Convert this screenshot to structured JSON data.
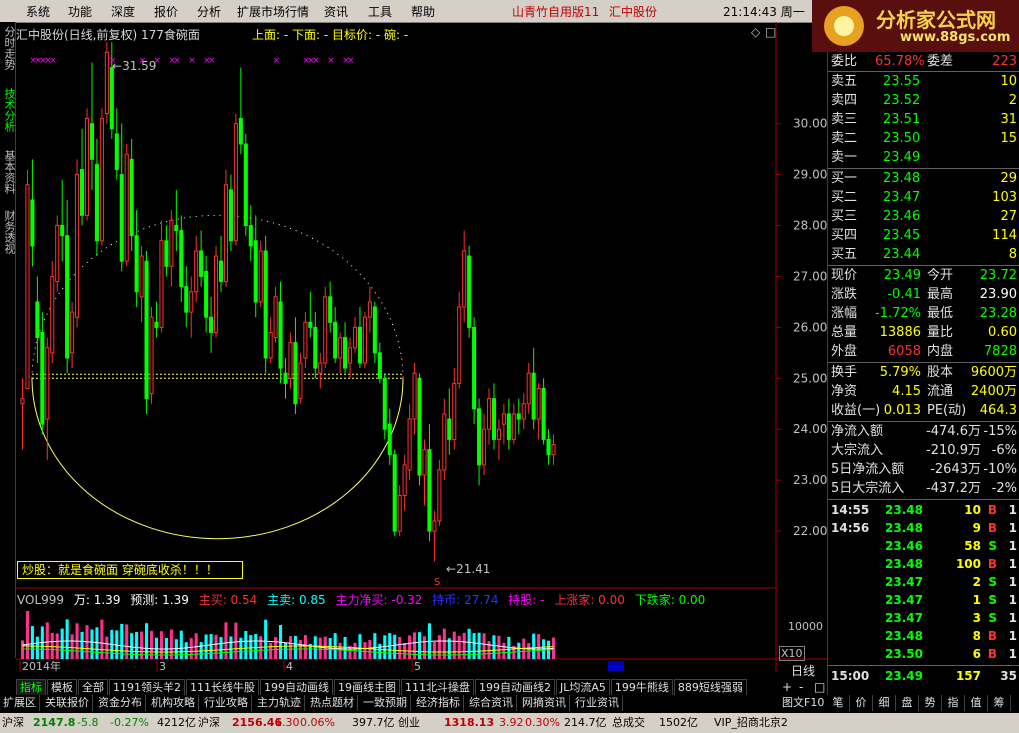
{
  "menu": {
    "items": [
      "系统",
      "功能",
      "深度",
      "报价",
      "分析",
      "扩展市场行情",
      "资讯",
      "工具",
      "帮助"
    ],
    "app_title": "山青竹自用版11",
    "stock_name": "汇中股份",
    "clock": "21:14:43 周一",
    "logo_text": "分析家公式网",
    "logo_url": "www.88gs.com"
  },
  "left_tabs": [
    "分时走势",
    "技术分析",
    "基本资料",
    "财务透视"
  ],
  "chart": {
    "title": "汇中股份(日线,前复权) 177食碗面",
    "info": "上面: -  下面: -  目标价: -  碗: -",
    "high_label": "31.59",
    "low_label": "21.41",
    "formula_text": "炒股：就是食碗面   穿碗底收杀！！！",
    "bottom_marker": "S"
  },
  "chart_data": {
    "type": "candlestick",
    "y_ticks": [
      "30.00",
      "29.00",
      "28.00",
      "27.00",
      "26.00",
      "25.00",
      "24.00",
      "23.00",
      "22.00"
    ],
    "ylim": [
      21.0,
      31.8
    ],
    "x_labels": [
      "2014年",
      "3",
      "4",
      "5"
    ],
    "candles": [
      [
        24.5,
        25.0,
        23.6,
        24.6
      ],
      [
        24.8,
        29.1,
        24.8,
        28.8
      ],
      [
        28.5,
        29.3,
        27.2,
        27.6
      ],
      [
        26.5,
        27.0,
        25.3,
        25.8
      ],
      [
        25.9,
        26.3,
        23.9,
        24.1
      ],
      [
        24.2,
        25.8,
        23.4,
        25.6
      ],
      [
        25.5,
        27.3,
        25.3,
        27.0
      ],
      [
        26.9,
        28.2,
        26.7,
        28.0
      ],
      [
        28.0,
        28.9,
        27.3,
        27.8
      ],
      [
        27.8,
        28.5,
        25.1,
        25.4
      ],
      [
        25.5,
        26.5,
        25.2,
        26.3
      ],
      [
        26.2,
        29.3,
        26.0,
        29.0
      ],
      [
        29.1,
        29.9,
        28.0,
        28.2
      ],
      [
        28.2,
        30.3,
        28.1,
        30.1
      ],
      [
        30.0,
        31.2,
        28.7,
        29.3
      ],
      [
        29.2,
        29.7,
        27.4,
        27.7
      ],
      [
        27.7,
        30.3,
        27.6,
        30.1
      ],
      [
        30.2,
        31.6,
        30.0,
        31.4
      ],
      [
        31.1,
        31.6,
        29.7,
        29.9
      ],
      [
        29.8,
        30.3,
        28.9,
        29.1
      ],
      [
        29.0,
        30.0,
        27.1,
        27.3
      ],
      [
        27.3,
        29.6,
        27.2,
        29.4
      ],
      [
        29.3,
        29.7,
        27.5,
        27.8
      ],
      [
        27.8,
        28.3,
        26.4,
        26.7
      ],
      [
        26.6,
        27.6,
        26.1,
        27.4
      ],
      [
        27.3,
        27.5,
        24.3,
        24.6
      ],
      [
        24.7,
        26.4,
        24.5,
        26.2
      ],
      [
        26.1,
        26.5,
        25.8,
        26.0
      ],
      [
        26.0,
        28.1,
        25.9,
        27.7
      ],
      [
        27.7,
        28.0,
        27.0,
        27.2
      ],
      [
        27.2,
        28.3,
        26.8,
        28.1
      ],
      [
        28.0,
        28.7,
        27.5,
        27.9
      ],
      [
        27.9,
        28.2,
        26.5,
        26.8
      ],
      [
        26.8,
        27.2,
        26.0,
        26.3
      ],
      [
        26.3,
        27.0,
        25.8,
        26.7
      ],
      [
        26.7,
        27.8,
        26.5,
        27.5
      ],
      [
        27.5,
        27.9,
        26.8,
        27.0
      ],
      [
        27.1,
        27.4,
        25.9,
        26.2
      ],
      [
        26.2,
        26.6,
        25.5,
        25.9
      ],
      [
        25.9,
        27.6,
        25.8,
        27.4
      ],
      [
        27.3,
        27.8,
        26.7,
        26.9
      ],
      [
        26.9,
        29.1,
        26.8,
        28.8
      ],
      [
        28.7,
        29.0,
        27.5,
        27.7
      ],
      [
        27.7,
        30.2,
        27.6,
        30.0
      ],
      [
        30.1,
        31.1,
        29.4,
        29.6
      ],
      [
        29.6,
        29.8,
        27.8,
        28.0
      ],
      [
        28.0,
        28.4,
        27.3,
        27.6
      ],
      [
        27.7,
        28.2,
        26.2,
        26.5
      ],
      [
        26.5,
        27.7,
        26.4,
        27.5
      ],
      [
        27.5,
        27.8,
        25.1,
        25.4
      ],
      [
        25.4,
        26.2,
        25.3,
        25.9
      ],
      [
        25.8,
        26.8,
        25.7,
        26.6
      ],
      [
        26.5,
        26.9,
        24.9,
        25.2
      ],
      [
        25.1,
        25.4,
        24.6,
        24.9
      ],
      [
        25.0,
        25.9,
        24.8,
        25.7
      ],
      [
        25.7,
        26.2,
        24.3,
        24.5
      ],
      [
        24.6,
        25.5,
        24.5,
        25.3
      ],
      [
        25.4,
        26.3,
        25.2,
        26.1
      ],
      [
        26.1,
        26.7,
        25.8,
        26.0
      ],
      [
        26.0,
        26.3,
        25.0,
        25.2
      ],
      [
        25.1,
        25.5,
        24.8,
        25.3
      ],
      [
        25.3,
        26.8,
        25.2,
        26.6
      ],
      [
        26.6,
        26.9,
        25.9,
        26.1
      ],
      [
        26.1,
        26.4,
        25.3,
        25.4
      ],
      [
        25.4,
        25.9,
        25.1,
        25.8
      ],
      [
        25.8,
        26.1,
        25.1,
        25.2
      ],
      [
        25.3,
        25.8,
        25.0,
        25.6
      ],
      [
        25.6,
        26.2,
        25.5,
        26.0
      ],
      [
        26.0,
        26.4,
        25.2,
        25.3
      ],
      [
        25.3,
        26.3,
        25.2,
        26.2
      ],
      [
        26.2,
        26.8,
        25.9,
        26.5
      ],
      [
        26.4,
        26.5,
        25.3,
        25.5
      ],
      [
        25.5,
        25.7,
        24.9,
        25.0
      ],
      [
        25.0,
        25.1,
        23.8,
        24.0
      ],
      [
        24.1,
        24.4,
        23.3,
        23.5
      ],
      [
        23.5,
        23.6,
        21.9,
        22.0
      ],
      [
        22.0,
        22.9,
        21.9,
        22.7
      ],
      [
        22.7,
        23.5,
        22.4,
        23.3
      ],
      [
        23.2,
        24.5,
        23.0,
        24.2
      ],
      [
        24.2,
        25.3,
        23.9,
        25.1
      ],
      [
        25.0,
        25.1,
        22.9,
        23.1
      ],
      [
        23.1,
        23.8,
        22.5,
        23.6
      ],
      [
        23.6,
        24.1,
        21.8,
        22.0
      ],
      [
        22.0,
        22.4,
        21.4,
        22.2
      ],
      [
        22.2,
        23.4,
        22.1,
        23.2
      ],
      [
        23.2,
        24.6,
        23.0,
        24.3
      ],
      [
        24.2,
        24.8,
        23.5,
        23.8
      ],
      [
        23.8,
        25.2,
        23.6,
        24.9
      ],
      [
        24.9,
        26.7,
        24.8,
        26.4
      ],
      [
        26.4,
        27.9,
        26.1,
        27.5
      ],
      [
        27.4,
        27.6,
        25.8,
        26.0
      ],
      [
        26.0,
        26.2,
        24.1,
        24.4
      ],
      [
        24.4,
        24.6,
        22.9,
        23.3
      ],
      [
        23.3,
        24.3,
        23.1,
        24.0
      ],
      [
        24.0,
        24.8,
        23.7,
        24.6
      ],
      [
        24.6,
        24.9,
        23.6,
        23.8
      ],
      [
        23.8,
        24.2,
        23.4,
        24.0
      ],
      [
        24.1,
        24.5,
        23.7,
        24.3
      ],
      [
        24.3,
        24.6,
        23.6,
        23.8
      ],
      [
        23.8,
        24.5,
        23.7,
        24.3
      ],
      [
        24.3,
        24.6,
        23.9,
        24.2
      ],
      [
        24.2,
        24.7,
        24.0,
        24.5
      ],
      [
        24.5,
        25.3,
        24.3,
        25.1
      ],
      [
        25.1,
        25.6,
        24.0,
        24.2
      ],
      [
        24.2,
        24.9,
        23.8,
        24.8
      ],
      [
        24.8,
        25.0,
        23.7,
        23.8
      ],
      [
        23.8,
        24.0,
        23.3,
        23.5
      ],
      [
        23.5,
        23.9,
        23.3,
        23.7
      ]
    ],
    "volume_label": "10000",
    "x10": "X10"
  },
  "vol_header": {
    "vol": "VOL999",
    "items": [
      {
        "label": "万: 1.39",
        "color": "#ffffff"
      },
      {
        "label": "预测: 1.39",
        "color": "#ffffff"
      },
      {
        "label": "主买: 0.54",
        "color": "#ff3030"
      },
      {
        "label": "主卖: 0.85",
        "color": "#00ffff"
      },
      {
        "label": "主力净买: -0.32",
        "color": "#ff00ff"
      },
      {
        "label": "持币: 27.74",
        "color": "#3030ff"
      },
      {
        "label": "持股: -",
        "color": "#ff00ff"
      },
      {
        "label": "上涨家: 0.00",
        "color": "#ff3030"
      },
      {
        "label": "下跌家: 0.00",
        "color": "#00ff00"
      }
    ]
  },
  "period_label": "日线",
  "tabs1": [
    "指标",
    "模板",
    "全部",
    "1191领头羊2",
    "111长线牛股",
    "199自动画线",
    "19画线主图",
    "111北斗操盘",
    "199自动画线2",
    "JL均流A5",
    "199牛熊线",
    "889短线强弱"
  ],
  "tabs2": [
    "扩展区",
    "关联报价",
    "资金分布",
    "机构攻略",
    "行业攻略",
    "主力轨迹",
    "热点题材",
    "一致预期",
    "经济指标",
    "综合资讯",
    "网摘资讯",
    "行业资讯"
  ],
  "tabs2_right": "图文F10",
  "status": [
    {
      "t": "沪深",
      "c": "#000000"
    },
    {
      "t": "2147.8",
      "c": "#008000"
    },
    {
      "t": "-5.8",
      "c": "#008000"
    },
    {
      "t": "-0.27%",
      "c": "#008000"
    },
    {
      "t": "4212亿",
      "c": "#000000"
    },
    {
      "t": "沪深",
      "c": "#000000"
    },
    {
      "t": "2156.46",
      "c": "#c00000"
    },
    {
      "t": "1.30",
      "c": "#c00000"
    },
    {
      "t": "0.06%",
      "c": "#c00000"
    },
    {
      "t": "397.7亿",
      "c": "#000000"
    },
    {
      "t": "创业",
      "c": "#000000"
    },
    {
      "t": "1318.13",
      "c": "#c00000"
    },
    {
      "t": "3.92",
      "c": "#c00000"
    },
    {
      "t": "0.30%",
      "c": "#c00000"
    },
    {
      "t": "214.7亿",
      "c": "#000000"
    },
    {
      "t": "总成交",
      "c": "#000000"
    },
    {
      "t": "1502亿",
      "c": "#000000"
    },
    {
      "t": "VIP_招商北京2",
      "c": "#000000"
    }
  ],
  "quote": {
    "ratio": {
      "l1": "委比",
      "v1": "65.78%",
      "l2": "委差",
      "v2": "223"
    },
    "sell": [
      {
        "l": "卖五",
        "p": "23.55",
        "q": "10"
      },
      {
        "l": "卖四",
        "p": "23.52",
        "q": "2"
      },
      {
        "l": "卖三",
        "p": "23.51",
        "q": "31"
      },
      {
        "l": "卖二",
        "p": "23.50",
        "q": "15"
      },
      {
        "l": "卖一",
        "p": "23.49",
        "q": ""
      }
    ],
    "buy": [
      {
        "l": "买一",
        "p": "23.48",
        "q": "29"
      },
      {
        "l": "买二",
        "p": "23.47",
        "q": "103"
      },
      {
        "l": "买三",
        "p": "23.46",
        "q": "27"
      },
      {
        "l": "买四",
        "p": "23.45",
        "q": "114"
      },
      {
        "l": "买五",
        "p": "23.44",
        "q": "8"
      }
    ],
    "stats": [
      {
        "l1": "现价",
        "v1": "23.49",
        "c1": "#00ff00",
        "l2": "今开",
        "v2": "23.72",
        "c2": "#00ff00"
      },
      {
        "l1": "涨跌",
        "v1": "-0.41",
        "c1": "#00ff00",
        "l2": "最高",
        "v2": "23.90",
        "c2": "#ffffff"
      },
      {
        "l1": "涨幅",
        "v1": "-1.72%",
        "c1": "#00ff00",
        "l2": "最低",
        "v2": "23.28",
        "c2": "#00ff00"
      },
      {
        "l1": "总量",
        "v1": "13886",
        "c1": "#ffff00",
        "l2": "量比",
        "v2": "0.60",
        "c2": "#ffff00"
      },
      {
        "l1": "外盘",
        "v1": "6058",
        "c1": "#ff3030",
        "l2": "内盘",
        "v2": "7828",
        "c2": "#00ff00"
      }
    ],
    "fund": [
      {
        "l1": "换手",
        "v1": "5.79%",
        "c1": "#ffff00",
        "l2": "股本",
        "v2": "9600万",
        "c2": "#ffff00"
      },
      {
        "l1": "净资",
        "v1": "4.15",
        "c1": "#ffff00",
        "l2": "流通",
        "v2": "2400万",
        "c2": "#ffff00"
      },
      {
        "l1": "收益(一)",
        "v1": "0.013",
        "c1": "#ffff00",
        "l2": "PE(动)",
        "v2": "464.3",
        "c2": "#ffff00"
      }
    ],
    "flows": [
      {
        "l": "净流入额",
        "v": "-474.6万",
        "p": "-15%"
      },
      {
        "l": "大宗流入",
        "v": "-210.9万",
        "p": "-6%"
      },
      {
        "l": "5日净流入额",
        "v": "-2643万",
        "p": "-10%"
      },
      {
        "l": "5日大宗流入",
        "v": "-437.2万",
        "p": "-2%"
      }
    ],
    "ticks": [
      {
        "t": "14:55",
        "p": "23.48",
        "q": "10",
        "bs": "B",
        "x": "1"
      },
      {
        "t": "14:56",
        "p": "23.48",
        "q": "9",
        "bs": "B",
        "x": "1"
      },
      {
        "t": "",
        "p": "23.46",
        "q": "58",
        "bs": "S",
        "x": "1"
      },
      {
        "t": "",
        "p": "23.48",
        "q": "100",
        "bs": "B",
        "x": "1"
      },
      {
        "t": "",
        "p": "23.47",
        "q": "2",
        "bs": "S",
        "x": "1"
      },
      {
        "t": "",
        "p": "23.47",
        "q": "1",
        "bs": "S",
        "x": "1"
      },
      {
        "t": "",
        "p": "23.47",
        "q": "3",
        "bs": "S",
        "x": "1"
      },
      {
        "t": "",
        "p": "23.48",
        "q": "8",
        "bs": "B",
        "x": "1"
      },
      {
        "t": "",
        "p": "23.50",
        "q": "6",
        "bs": "B",
        "x": "1"
      },
      {
        "t": "15:00",
        "p": "23.49",
        "q": "157",
        "bs": "",
        "x": "35"
      }
    ]
  },
  "bottom_icons": [
    "笔",
    "价",
    "细",
    "盘",
    "势",
    "指",
    "值",
    "筹"
  ]
}
